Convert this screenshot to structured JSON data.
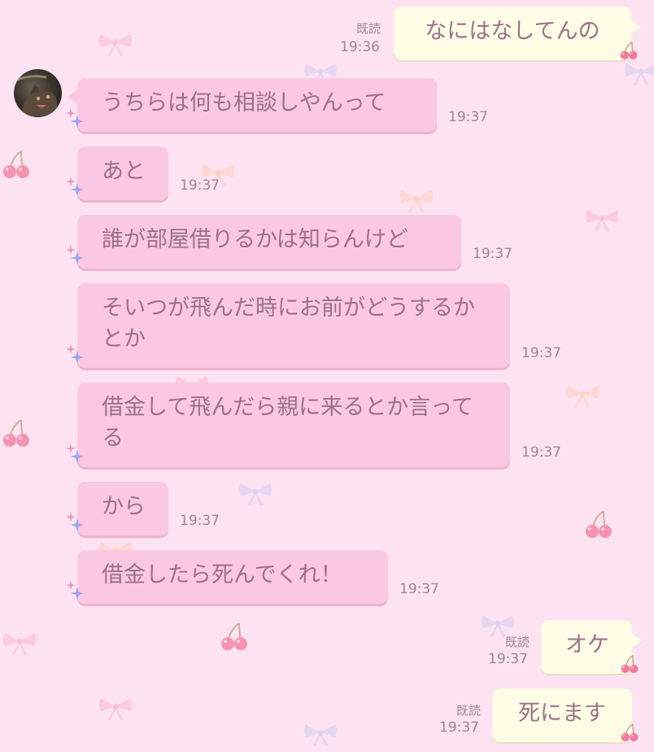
{
  "colors": {
    "background": "#fde3f1",
    "incoming_bubble": "#fac8e2",
    "outgoing_bubble": "#fffde6",
    "text": "#9a7288",
    "timestamp": "#9b8794"
  },
  "contact": {
    "avatar_icon": "cat-photo-icon"
  },
  "messages": [
    {
      "side": "out",
      "text": "なにはなしてんの",
      "read": "既読",
      "time": "19:36"
    },
    {
      "side": "in",
      "text": "うちらは何も相談しやんって",
      "time": "19:37"
    },
    {
      "side": "in",
      "text": "あと",
      "time": "19:37"
    },
    {
      "side": "in",
      "text": "誰が部屋借りるかは知らんけど",
      "time": "19:37"
    },
    {
      "side": "in",
      "text": "そいつが飛んだ時にお前がどうするかとか",
      "time": "19:37"
    },
    {
      "side": "in",
      "text": "借金して飛んだら親に来るとか言ってる",
      "time": "19:37"
    },
    {
      "side": "in",
      "text": "から",
      "time": "19:37"
    },
    {
      "side": "in",
      "text": "借金したら死んでくれ！",
      "time": "19:37"
    },
    {
      "side": "out",
      "text": "オケ",
      "read": "既読",
      "time": "19:37"
    },
    {
      "side": "out",
      "text": "死にます",
      "read": "既読",
      "time": "19:37"
    }
  ]
}
